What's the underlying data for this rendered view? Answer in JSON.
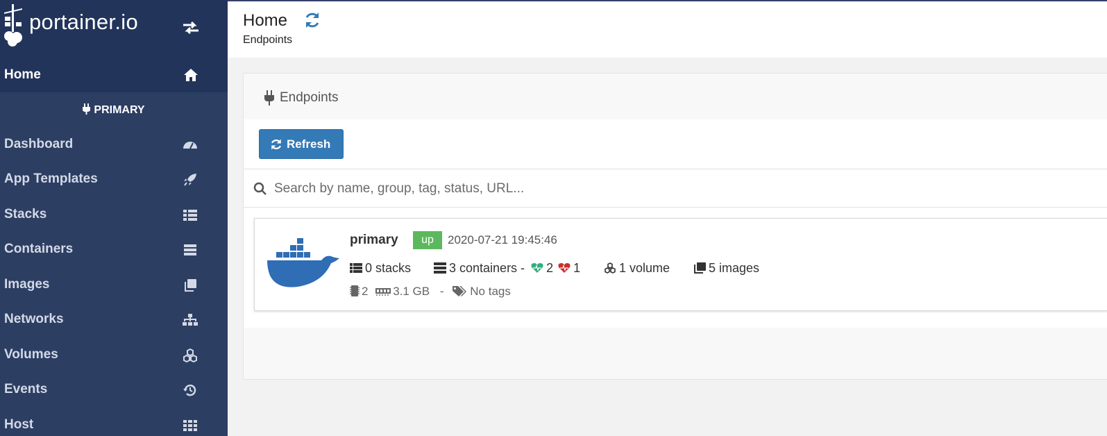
{
  "brand": {
    "name": "portainer.io"
  },
  "colors": {
    "sidebar": "#2d3e63",
    "sidebar_dark": "#23345b",
    "primary": "#337ab7",
    "status_up": "#5cb85c",
    "healthy": "#2fae7c",
    "unhealthy": "#c9302c"
  },
  "sidebar": {
    "home": {
      "label": "Home",
      "icon": "home-icon"
    },
    "endpoint_header": {
      "label": "PRIMARY",
      "icon": "plug-icon"
    },
    "items": [
      {
        "label": "Dashboard",
        "icon": "tachometer-icon"
      },
      {
        "label": "App Templates",
        "icon": "rocket-icon"
      },
      {
        "label": "Stacks",
        "icon": "th-list-icon"
      },
      {
        "label": "Containers",
        "icon": "server-icon"
      },
      {
        "label": "Images",
        "icon": "clone-icon"
      },
      {
        "label": "Networks",
        "icon": "sitemap-icon"
      },
      {
        "label": "Volumes",
        "icon": "cubes-icon"
      },
      {
        "label": "Events",
        "icon": "history-icon"
      },
      {
        "label": "Host",
        "icon": "th-icon"
      }
    ]
  },
  "header": {
    "title": "Home",
    "subtitle": "Endpoints"
  },
  "widget": {
    "title": "Endpoints",
    "refresh_label": "Refresh",
    "search_placeholder": "Search by name, group, tag, status, URL..."
  },
  "endpoints": [
    {
      "name": "primary",
      "status": "up",
      "timestamp": "2020-07-21 19:45:46",
      "stacks": "0 stacks",
      "containers": "3 containers -",
      "healthy": "2",
      "unhealthy": "1",
      "volumes": "1 volume",
      "images": "5 images",
      "cpu": "2",
      "memory": "3.1 GB",
      "separator": "-",
      "tags": "No tags"
    }
  ]
}
